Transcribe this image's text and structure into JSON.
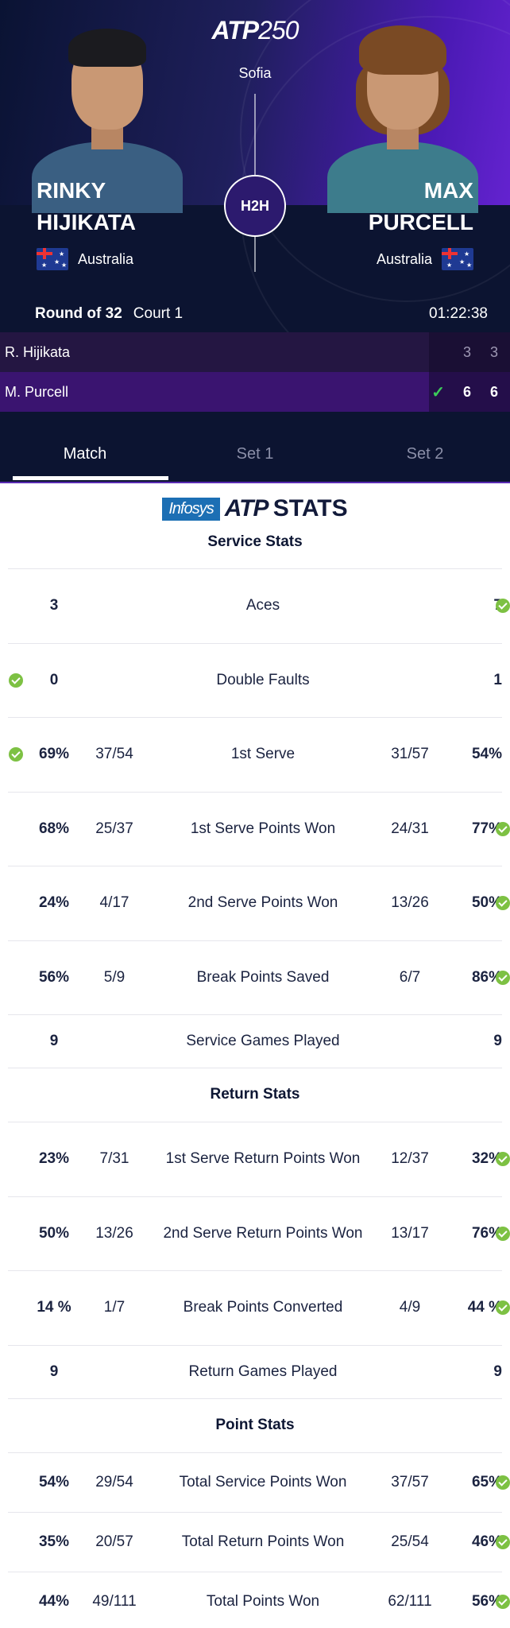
{
  "header": {
    "logo_prefix": "ATP",
    "logo_number": "250",
    "location": "Sofia",
    "h2h_label": "H2H",
    "left_player": {
      "first": "RINKY",
      "last": "HIJIKATA",
      "country": "Australia"
    },
    "right_player": {
      "first": "MAX",
      "last": "PURCELL",
      "country": "Australia"
    },
    "round": "Round of 32",
    "court": "Court 1",
    "duration": "01:22:38"
  },
  "scores": [
    {
      "name": "R. Hijikata",
      "winner": false,
      "sets": [
        "3",
        "3"
      ]
    },
    {
      "name": "M. Purcell",
      "winner": true,
      "sets": [
        "6",
        "6"
      ]
    }
  ],
  "tabs": [
    {
      "label": "Match",
      "active": true
    },
    {
      "label": "Set 1",
      "active": false
    },
    {
      "label": "Set 2",
      "active": false
    }
  ],
  "stats_brand": {
    "sponsor": "Infosys",
    "atp": "ATP",
    "word": "STATS"
  },
  "sections": {
    "service": {
      "title": "Service Stats",
      "rows": [
        {
          "label": "Aces",
          "lpct": "3",
          "lfrac": "",
          "rfrac": "",
          "rpct": "7",
          "lcheck": false,
          "rcheck": true
        },
        {
          "label": "Double Faults",
          "lpct": "0",
          "lfrac": "",
          "rfrac": "",
          "rpct": "1",
          "lcheck": true,
          "rcheck": false
        },
        {
          "label": "1st Serve",
          "lpct": "69%",
          "lfrac": "37/54",
          "rfrac": "31/57",
          "rpct": "54%",
          "lcheck": true,
          "rcheck": false
        },
        {
          "label": "1st Serve Points Won",
          "lpct": "68%",
          "lfrac": "25/37",
          "rfrac": "24/31",
          "rpct": "77%",
          "lcheck": false,
          "rcheck": true
        },
        {
          "label": "2nd Serve Points Won",
          "lpct": "24%",
          "lfrac": "4/17",
          "rfrac": "13/26",
          "rpct": "50%",
          "lcheck": false,
          "rcheck": true
        },
        {
          "label": "Break Points Saved",
          "lpct": "56%",
          "lfrac": "5/9",
          "rfrac": "6/7",
          "rpct": "86%",
          "lcheck": false,
          "rcheck": true
        },
        {
          "label": "Service Games Played",
          "lpct": "9",
          "lfrac": "",
          "rfrac": "",
          "rpct": "9",
          "lcheck": false,
          "rcheck": false
        }
      ]
    },
    "return": {
      "title": "Return Stats",
      "rows": [
        {
          "label": "1st Serve Return Points Won",
          "lpct": "23%",
          "lfrac": "7/31",
          "rfrac": "12/37",
          "rpct": "32%",
          "lcheck": false,
          "rcheck": true
        },
        {
          "label": "2nd Serve Return Points Won",
          "lpct": "50%",
          "lfrac": "13/26",
          "rfrac": "13/17",
          "rpct": "76%",
          "lcheck": false,
          "rcheck": true
        },
        {
          "label": "Break Points Converted",
          "lpct": "14 %",
          "lfrac": "1/7",
          "rfrac": "4/9",
          "rpct": "44 %",
          "lcheck": false,
          "rcheck": true
        },
        {
          "label": "Return Games Played",
          "lpct": "9",
          "lfrac": "",
          "rfrac": "",
          "rpct": "9",
          "lcheck": false,
          "rcheck": false
        }
      ]
    },
    "points": {
      "title": "Point Stats",
      "rows": [
        {
          "label": "Total Service Points Won",
          "lpct": "54%",
          "lfrac": "29/54",
          "rfrac": "37/57",
          "rpct": "65%",
          "lcheck": false,
          "rcheck": true
        },
        {
          "label": "Total Return Points Won",
          "lpct": "35%",
          "lfrac": "20/57",
          "rfrac": "25/54",
          "rpct": "46%",
          "lcheck": false,
          "rcheck": true
        },
        {
          "label": "Total Points Won",
          "lpct": "44%",
          "lfrac": "49/111",
          "rfrac": "62/111",
          "rpct": "56%",
          "lcheck": false,
          "rcheck": true
        }
      ]
    }
  },
  "colors": {
    "header_dark": "#0c1431",
    "accent_purple": "#6a25d6",
    "check_green": "#7dc143"
  }
}
